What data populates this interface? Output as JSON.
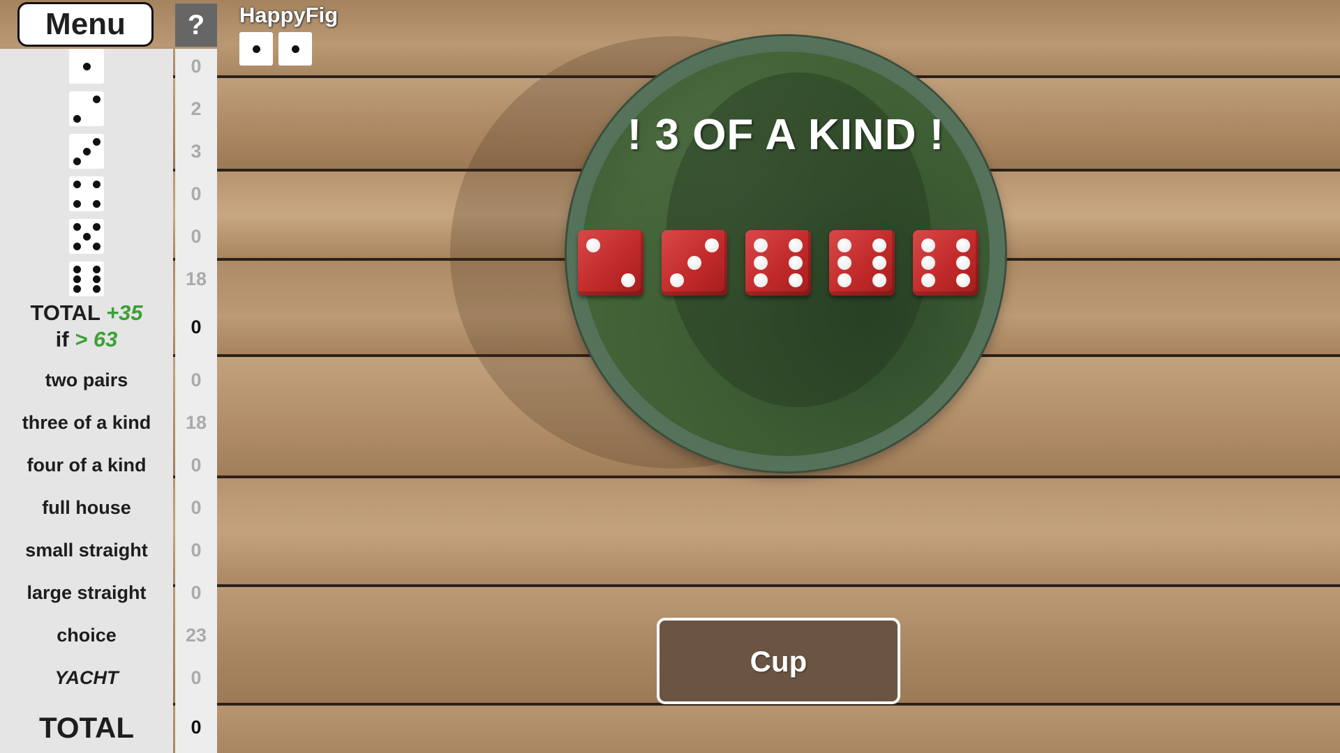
{
  "menu": {
    "label": "Menu"
  },
  "help": {
    "label": "?"
  },
  "player": {
    "name": "HappyFig",
    "avatar": [
      "die-one-icon",
      "die-one-icon"
    ]
  },
  "result": {
    "text": "! 3 OF A KIND !"
  },
  "dice": [
    2,
    3,
    6,
    6,
    6
  ],
  "cup_button": {
    "label": "Cup"
  },
  "upper": [
    {
      "face": 1,
      "score": "0"
    },
    {
      "face": 2,
      "score": "2"
    },
    {
      "face": 3,
      "score": "3"
    },
    {
      "face": 4,
      "score": "0"
    },
    {
      "face": 5,
      "score": "0"
    },
    {
      "face": 6,
      "score": "18"
    }
  ],
  "bonus": {
    "total_label": "TOTAL",
    "bonus_value": "+35",
    "if_label": "if",
    "threshold": "> 63",
    "score": "0"
  },
  "lower": [
    {
      "label": "two pairs",
      "score": "0"
    },
    {
      "label": "three of a kind",
      "score": "18"
    },
    {
      "label": "four of a kind",
      "score": "0"
    },
    {
      "label": "full house",
      "score": "0"
    },
    {
      "label": "small straight",
      "score": "0"
    },
    {
      "label": "large straight",
      "score": "0"
    },
    {
      "label": "choice",
      "score": "23"
    },
    {
      "label": "YACHT",
      "score": "0"
    }
  ],
  "grand_total": {
    "label": "TOTAL",
    "score": "0"
  },
  "colors": {
    "die_red": "#c22a2a",
    "felt_green": "#3b5a33",
    "bonus_green": "#3aa135",
    "cup_brown": "#6b5442"
  }
}
